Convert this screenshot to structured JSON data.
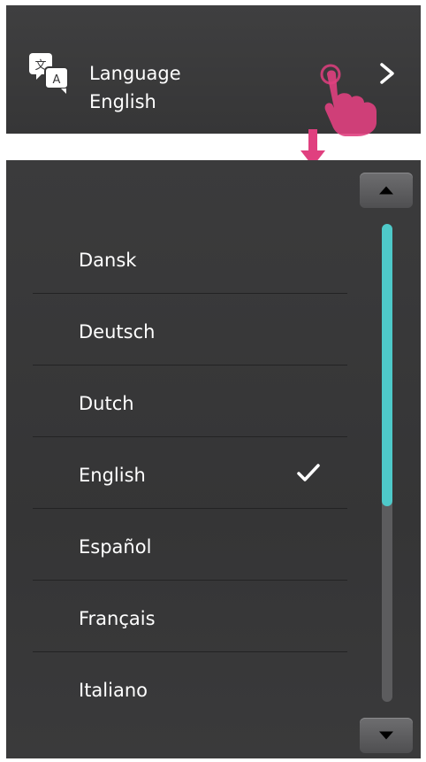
{
  "setting": {
    "title": "Language",
    "value": "English",
    "icon": "translate-icon",
    "chevron": "chevron-right-icon",
    "icon_glyph_top": "文",
    "icon_glyph_bottom": "A"
  },
  "picker": {
    "selected": "English",
    "items": [
      {
        "label": "Dansk",
        "checked": false
      },
      {
        "label": "Deutsch",
        "checked": false
      },
      {
        "label": "Dutch",
        "checked": false
      },
      {
        "label": "English",
        "checked": true
      },
      {
        "label": "Español",
        "checked": false
      },
      {
        "label": "Français",
        "checked": false
      },
      {
        "label": "Italiano",
        "checked": false
      }
    ],
    "scroll": {
      "up_icon": "scroll-up-icon",
      "down_icon": "scroll-down-icon",
      "thumb_fraction": 0.59,
      "position_fraction": 0.0
    }
  },
  "colors": {
    "accent": "#4ec9c9",
    "annotation": "#e0407f",
    "panel": "#363637",
    "text": "#ffffff"
  }
}
